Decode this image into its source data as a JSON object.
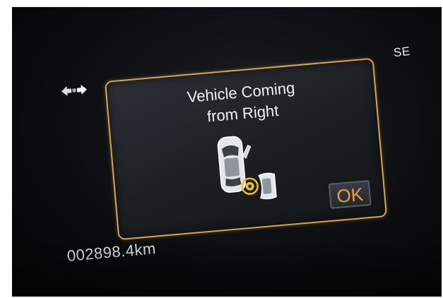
{
  "status_bar": {
    "compass_heading": "SE",
    "odometer": "002898.4km"
  },
  "icons": {
    "nav": "navigation-direction-icon",
    "car": "car-top-view-icon",
    "warning": "cross-traffic-warning-icon",
    "hazard": "approaching-vehicle-icon"
  },
  "alert": {
    "title_line1": "Vehicle Coming",
    "title_line2": "from Right",
    "ok_label": "OK"
  },
  "colors": {
    "accent": "#d7a450",
    "ok_text": "#e9a347",
    "warning": "#f0c020"
  }
}
